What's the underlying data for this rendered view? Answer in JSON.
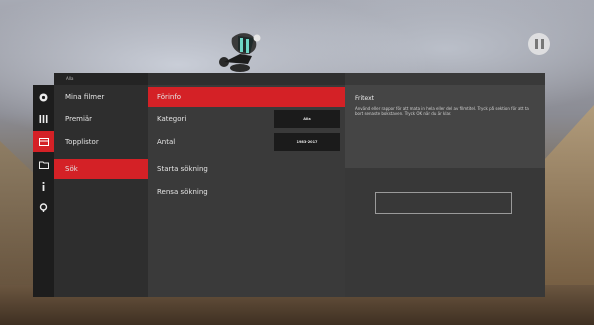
{
  "colors": {
    "accent": "#d42126"
  },
  "player": {
    "pause_icon": "pause-icon"
  },
  "panel": {
    "header_label": "Alla",
    "icons": [
      "record-icon",
      "bars-icon",
      "card-icon",
      "folder-icon",
      "info-icon",
      "search-icon"
    ],
    "menu": [
      {
        "label": "Mina filmer"
      },
      {
        "label": "Premiär"
      },
      {
        "label": "Topplistor"
      },
      {
        "label": "Sök"
      }
    ],
    "options": [
      {
        "label": "Förinfo"
      },
      {
        "label": "Kategori"
      },
      {
        "label": "Antal"
      },
      {
        "label": "Starta sökning"
      },
      {
        "label": "Rensa sökning"
      }
    ],
    "values": {
      "kategori": "Alla",
      "antal": "1983-2017"
    },
    "info": {
      "title": "Fritext",
      "text": "Använd eller rappor för att mata in hela eller del av filmtitel. Tryck på sektion för att ta bort senaste bokstaven. Tryck OK när du är klar."
    }
  }
}
